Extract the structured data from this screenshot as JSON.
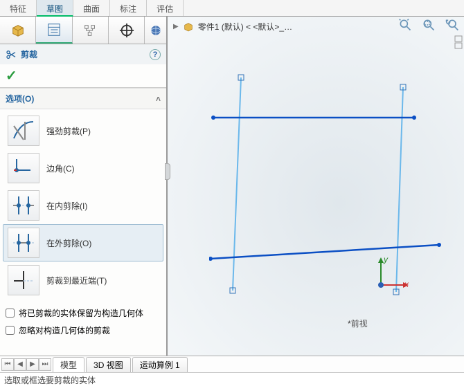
{
  "top_tabs": {
    "items": [
      "特征",
      "草图",
      "曲面",
      "标注",
      "评估"
    ],
    "active_index": 1
  },
  "tool_tabs": {
    "active_index": 1
  },
  "feature_panel": {
    "title": "剪裁",
    "help_tooltip": "帮助"
  },
  "section": {
    "title": "选项(O)"
  },
  "trim_options": [
    {
      "label": "强劲剪裁(P)"
    },
    {
      "label": "边角(C)"
    },
    {
      "label": "在内剪除(I)"
    },
    {
      "label": "在外剪除(O)"
    },
    {
      "label": "剪裁到最近端(T)"
    }
  ],
  "trim_selected_index": 3,
  "checks": [
    {
      "label": "将已剪裁的实体保留为构造几何体",
      "checked": false
    },
    {
      "label": "忽略对构造几何体的剪裁",
      "checked": false
    }
  ],
  "document": {
    "name": "零件1 (默认) < <默认>_…"
  },
  "front_view_label": "前视",
  "bottom_tabs": {
    "items": [
      "模型",
      "3D 视图",
      "运动算例 1"
    ],
    "active_index": 0
  },
  "status_text": "选取或框选要剪裁的实体",
  "colors": {
    "accent": "#2666a0",
    "sketch_active": "#0b4fc4",
    "sketch_inactive": "#6bb8eb",
    "ok": "#2b9c3f"
  }
}
